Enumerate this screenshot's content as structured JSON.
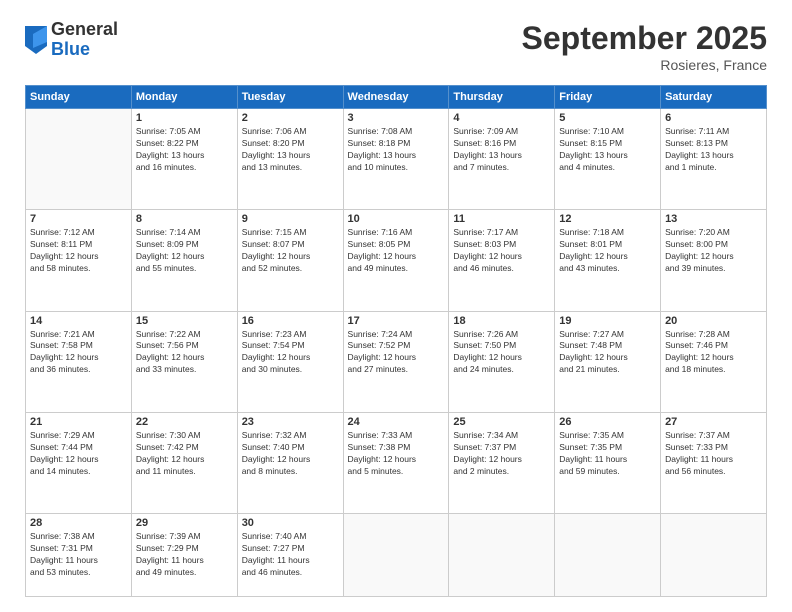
{
  "logo": {
    "general": "General",
    "blue": "Blue"
  },
  "title": {
    "month": "September 2025",
    "location": "Rosieres, France"
  },
  "weekdays": [
    "Sunday",
    "Monday",
    "Tuesday",
    "Wednesday",
    "Thursday",
    "Friday",
    "Saturday"
  ],
  "weeks": [
    [
      {
        "num": "",
        "info": ""
      },
      {
        "num": "1",
        "info": "Sunrise: 7:05 AM\nSunset: 8:22 PM\nDaylight: 13 hours\nand 16 minutes."
      },
      {
        "num": "2",
        "info": "Sunrise: 7:06 AM\nSunset: 8:20 PM\nDaylight: 13 hours\nand 13 minutes."
      },
      {
        "num": "3",
        "info": "Sunrise: 7:08 AM\nSunset: 8:18 PM\nDaylight: 13 hours\nand 10 minutes."
      },
      {
        "num": "4",
        "info": "Sunrise: 7:09 AM\nSunset: 8:16 PM\nDaylight: 13 hours\nand 7 minutes."
      },
      {
        "num": "5",
        "info": "Sunrise: 7:10 AM\nSunset: 8:15 PM\nDaylight: 13 hours\nand 4 minutes."
      },
      {
        "num": "6",
        "info": "Sunrise: 7:11 AM\nSunset: 8:13 PM\nDaylight: 13 hours\nand 1 minute."
      }
    ],
    [
      {
        "num": "7",
        "info": "Sunrise: 7:12 AM\nSunset: 8:11 PM\nDaylight: 12 hours\nand 58 minutes."
      },
      {
        "num": "8",
        "info": "Sunrise: 7:14 AM\nSunset: 8:09 PM\nDaylight: 12 hours\nand 55 minutes."
      },
      {
        "num": "9",
        "info": "Sunrise: 7:15 AM\nSunset: 8:07 PM\nDaylight: 12 hours\nand 52 minutes."
      },
      {
        "num": "10",
        "info": "Sunrise: 7:16 AM\nSunset: 8:05 PM\nDaylight: 12 hours\nand 49 minutes."
      },
      {
        "num": "11",
        "info": "Sunrise: 7:17 AM\nSunset: 8:03 PM\nDaylight: 12 hours\nand 46 minutes."
      },
      {
        "num": "12",
        "info": "Sunrise: 7:18 AM\nSunset: 8:01 PM\nDaylight: 12 hours\nand 43 minutes."
      },
      {
        "num": "13",
        "info": "Sunrise: 7:20 AM\nSunset: 8:00 PM\nDaylight: 12 hours\nand 39 minutes."
      }
    ],
    [
      {
        "num": "14",
        "info": "Sunrise: 7:21 AM\nSunset: 7:58 PM\nDaylight: 12 hours\nand 36 minutes."
      },
      {
        "num": "15",
        "info": "Sunrise: 7:22 AM\nSunset: 7:56 PM\nDaylight: 12 hours\nand 33 minutes."
      },
      {
        "num": "16",
        "info": "Sunrise: 7:23 AM\nSunset: 7:54 PM\nDaylight: 12 hours\nand 30 minutes."
      },
      {
        "num": "17",
        "info": "Sunrise: 7:24 AM\nSunset: 7:52 PM\nDaylight: 12 hours\nand 27 minutes."
      },
      {
        "num": "18",
        "info": "Sunrise: 7:26 AM\nSunset: 7:50 PM\nDaylight: 12 hours\nand 24 minutes."
      },
      {
        "num": "19",
        "info": "Sunrise: 7:27 AM\nSunset: 7:48 PM\nDaylight: 12 hours\nand 21 minutes."
      },
      {
        "num": "20",
        "info": "Sunrise: 7:28 AM\nSunset: 7:46 PM\nDaylight: 12 hours\nand 18 minutes."
      }
    ],
    [
      {
        "num": "21",
        "info": "Sunrise: 7:29 AM\nSunset: 7:44 PM\nDaylight: 12 hours\nand 14 minutes."
      },
      {
        "num": "22",
        "info": "Sunrise: 7:30 AM\nSunset: 7:42 PM\nDaylight: 12 hours\nand 11 minutes."
      },
      {
        "num": "23",
        "info": "Sunrise: 7:32 AM\nSunset: 7:40 PM\nDaylight: 12 hours\nand 8 minutes."
      },
      {
        "num": "24",
        "info": "Sunrise: 7:33 AM\nSunset: 7:38 PM\nDaylight: 12 hours\nand 5 minutes."
      },
      {
        "num": "25",
        "info": "Sunrise: 7:34 AM\nSunset: 7:37 PM\nDaylight: 12 hours\nand 2 minutes."
      },
      {
        "num": "26",
        "info": "Sunrise: 7:35 AM\nSunset: 7:35 PM\nDaylight: 11 hours\nand 59 minutes."
      },
      {
        "num": "27",
        "info": "Sunrise: 7:37 AM\nSunset: 7:33 PM\nDaylight: 11 hours\nand 56 minutes."
      }
    ],
    [
      {
        "num": "28",
        "info": "Sunrise: 7:38 AM\nSunset: 7:31 PM\nDaylight: 11 hours\nand 53 minutes."
      },
      {
        "num": "29",
        "info": "Sunrise: 7:39 AM\nSunset: 7:29 PM\nDaylight: 11 hours\nand 49 minutes."
      },
      {
        "num": "30",
        "info": "Sunrise: 7:40 AM\nSunset: 7:27 PM\nDaylight: 11 hours\nand 46 minutes."
      },
      {
        "num": "",
        "info": ""
      },
      {
        "num": "",
        "info": ""
      },
      {
        "num": "",
        "info": ""
      },
      {
        "num": "",
        "info": ""
      }
    ]
  ]
}
